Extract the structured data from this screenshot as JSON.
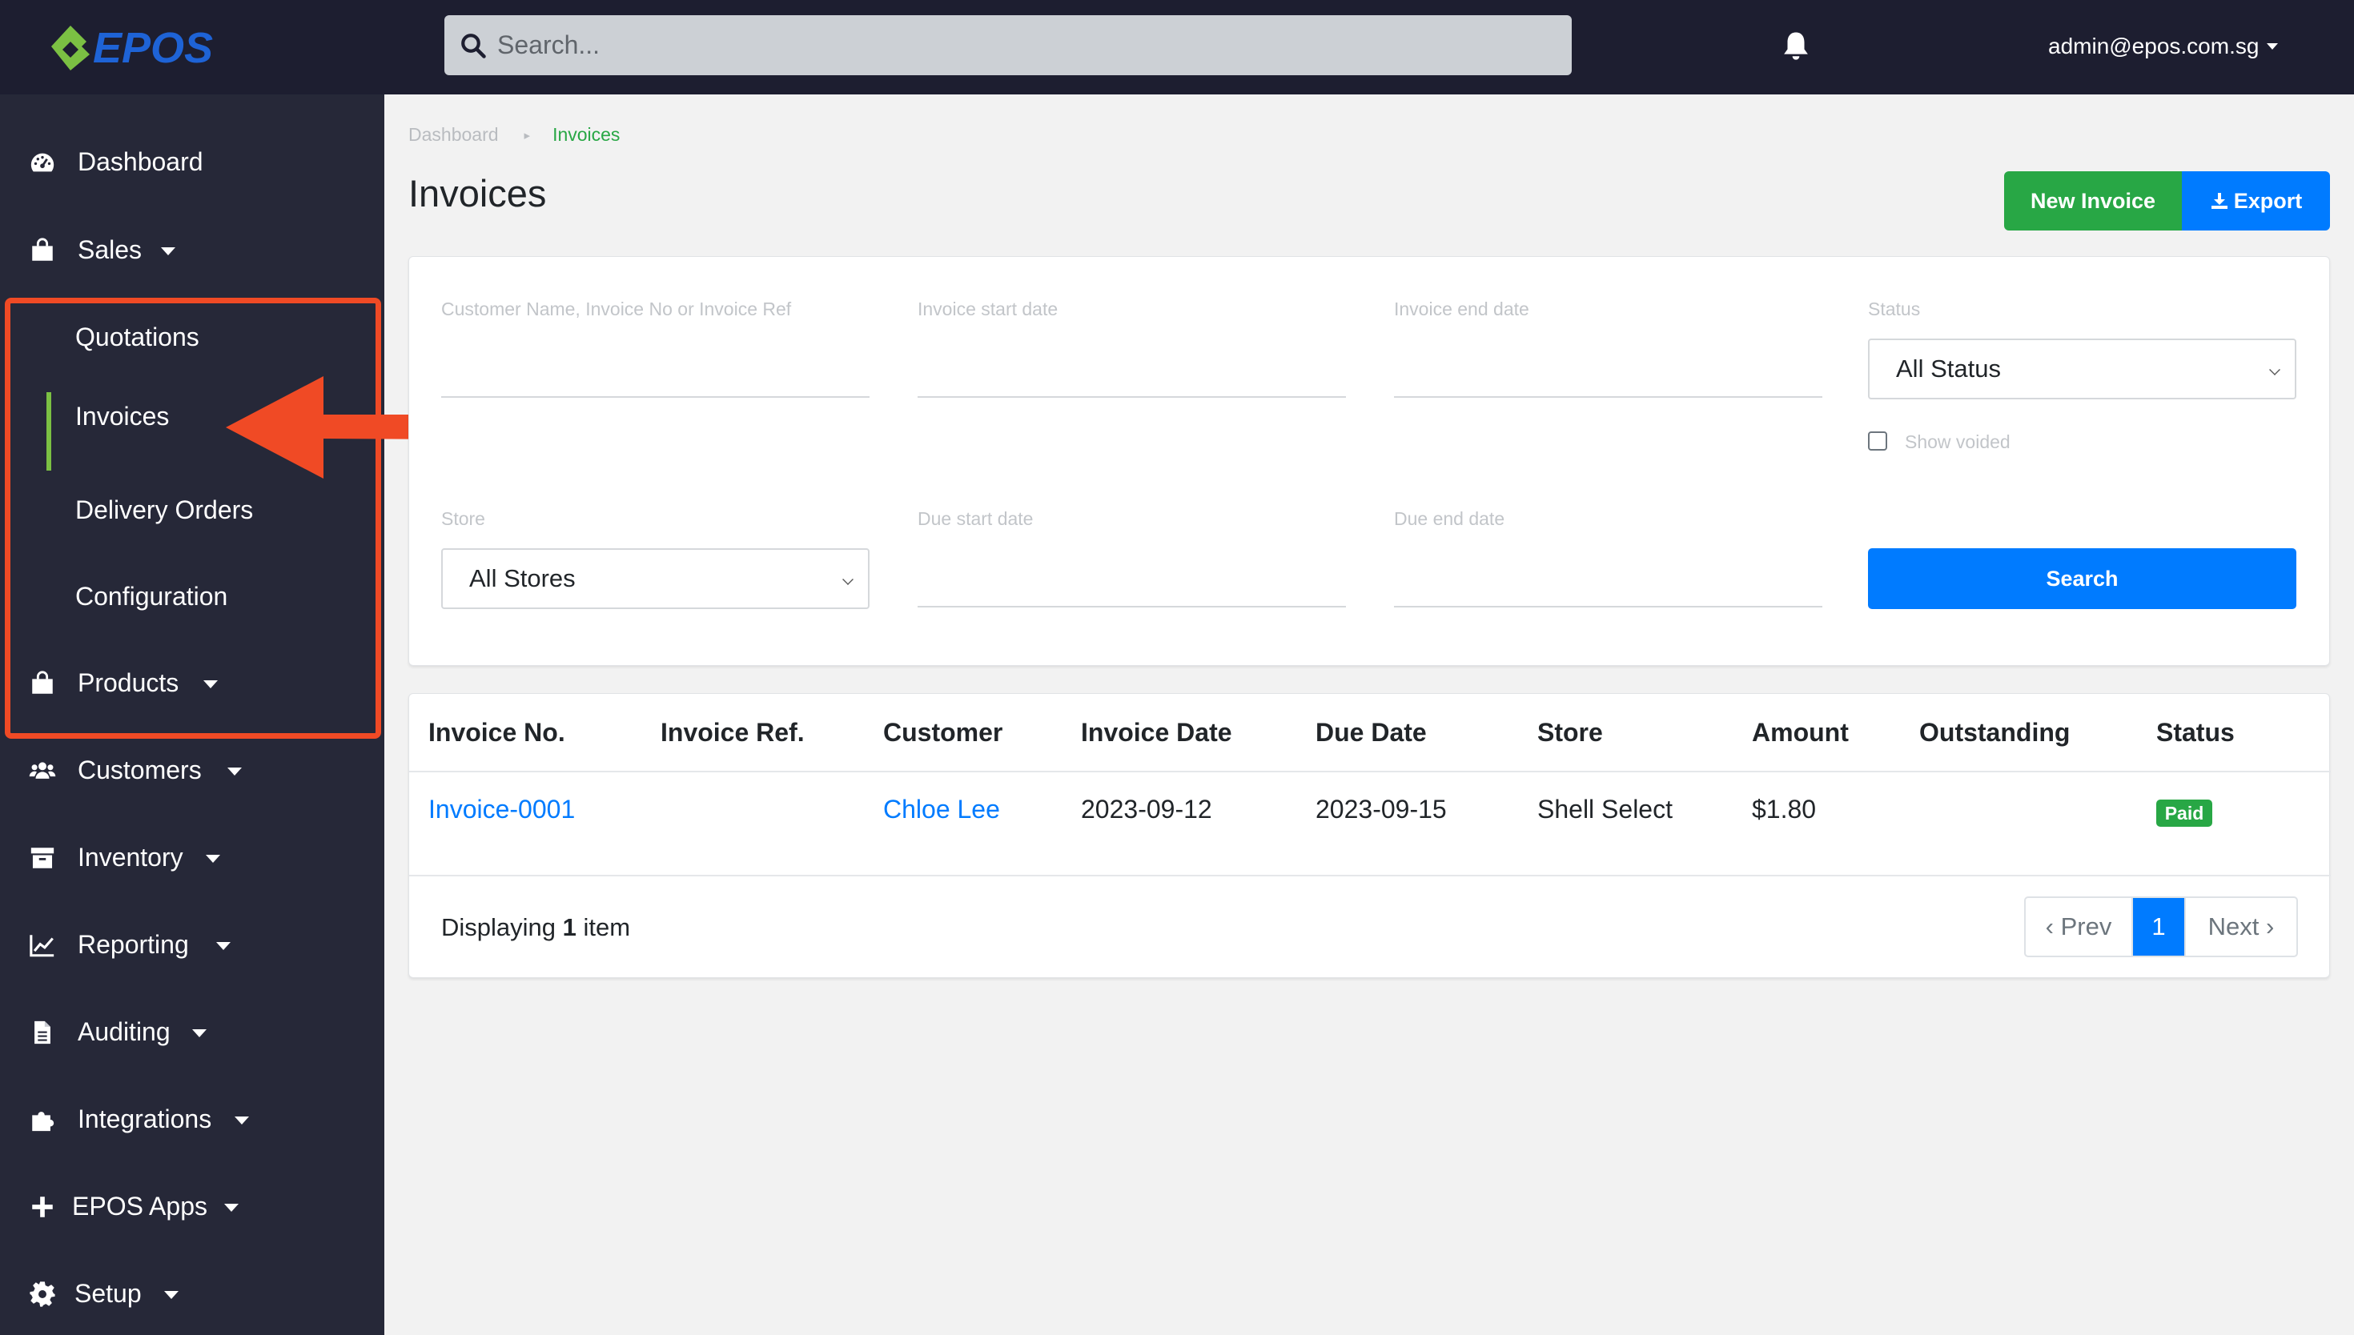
{
  "header": {
    "logo_text": "EPOS",
    "search_placeholder": "Search...",
    "user_email": "admin@epos.com.sg"
  },
  "sidebar": {
    "items": [
      {
        "label": "Dashboard",
        "icon": "dashboard-icon"
      },
      {
        "label": "Sales",
        "icon": "shopping-bag-icon"
      },
      {
        "label": "Products",
        "icon": "shopping-bag-icon"
      },
      {
        "label": "Customers",
        "icon": "users-icon"
      },
      {
        "label": "Inventory",
        "icon": "archive-icon"
      },
      {
        "label": "Reporting",
        "icon": "chart-line-icon"
      },
      {
        "label": "Auditing",
        "icon": "file-icon"
      },
      {
        "label": "Integrations",
        "icon": "puzzle-icon"
      },
      {
        "label": "EPOS Apps",
        "icon": "plus-icon"
      },
      {
        "label": "Setup",
        "icon": "gear-icon"
      }
    ],
    "sales_sub": [
      "Quotations",
      "Invoices",
      "Delivery Orders",
      "Configuration"
    ],
    "active_sub": "Invoices",
    "annotation_color": "#f04a25"
  },
  "breadcrumb": {
    "parent": "Dashboard",
    "current": "Invoices"
  },
  "page": {
    "title": "Invoices",
    "new_button": "New Invoice",
    "export_button": "Export"
  },
  "filters": {
    "customer_label": "Customer Name, Invoice No or Invoice Ref",
    "invoice_start_label": "Invoice start date",
    "invoice_end_label": "Invoice end date",
    "status_label": "Status",
    "status_value": "All Status",
    "show_voided_label": "Show voided",
    "store_label": "Store",
    "store_value": "All Stores",
    "due_start_label": "Due start date",
    "due_end_label": "Due end date",
    "search_button": "Search"
  },
  "table": {
    "headers": [
      "Invoice No.",
      "Invoice Ref.",
      "Customer",
      "Invoice Date",
      "Due Date",
      "Store",
      "Amount",
      "Outstanding",
      "Status"
    ],
    "rows": [
      {
        "invoice_no": "Invoice-0001",
        "invoice_ref": "",
        "customer": "Chloe Lee",
        "invoice_date": "2023-09-12",
        "due_date": "2023-09-15",
        "store": "Shell Select",
        "amount": "$1.80",
        "outstanding": "",
        "status": "Paid"
      }
    ],
    "display_prefix": "Displaying",
    "display_count": "1",
    "display_suffix": "item"
  },
  "pagination": {
    "prev": "‹ Prev",
    "current": "1",
    "next": "Next ›"
  },
  "colors": {
    "primary": "#007bff",
    "success": "#28a745",
    "sidebar": "#262838",
    "topbar": "#1d1e30",
    "brand_green": "#7bc043",
    "brand_blue": "#1e63d6"
  }
}
